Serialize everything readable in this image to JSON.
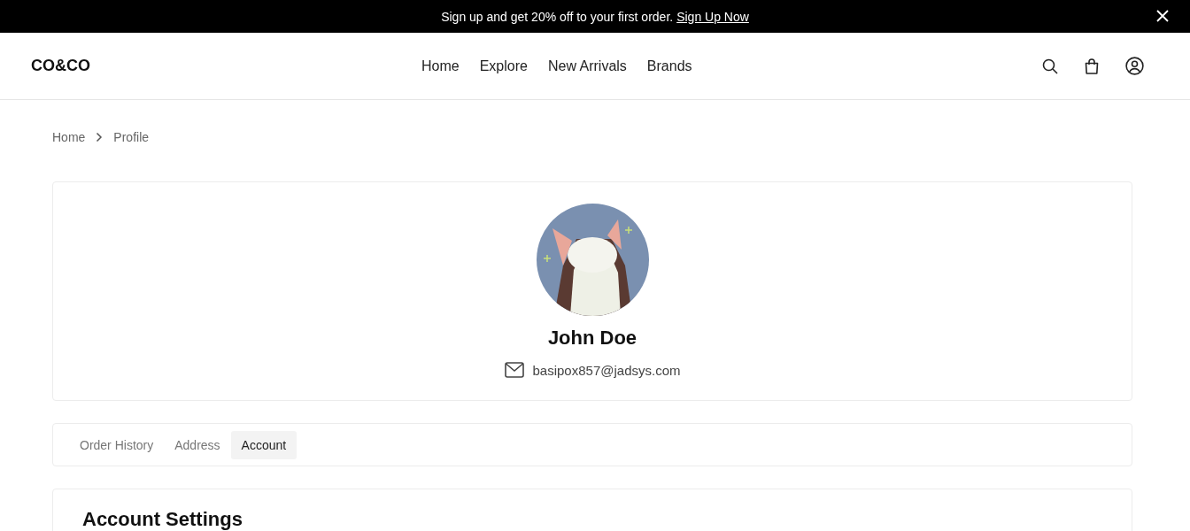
{
  "promo_bar": {
    "text": "Sign up and get 20% off to your first order.",
    "link": "Sign Up Now"
  },
  "header": {
    "logo": "CO&CO",
    "nav": [
      "Home",
      "Explore",
      "New Arrivals",
      "Brands"
    ]
  },
  "breadcrumb": [
    "Home",
    "Profile"
  ],
  "profile": {
    "name": "John Doe",
    "email": "basipox857@jadsys.com"
  },
  "tabs": [
    {
      "label": "Order History",
      "selected": false
    },
    {
      "label": "Address",
      "selected": false
    },
    {
      "label": "Account",
      "selected": true
    }
  ],
  "section": {
    "title": "Account Settings"
  }
}
